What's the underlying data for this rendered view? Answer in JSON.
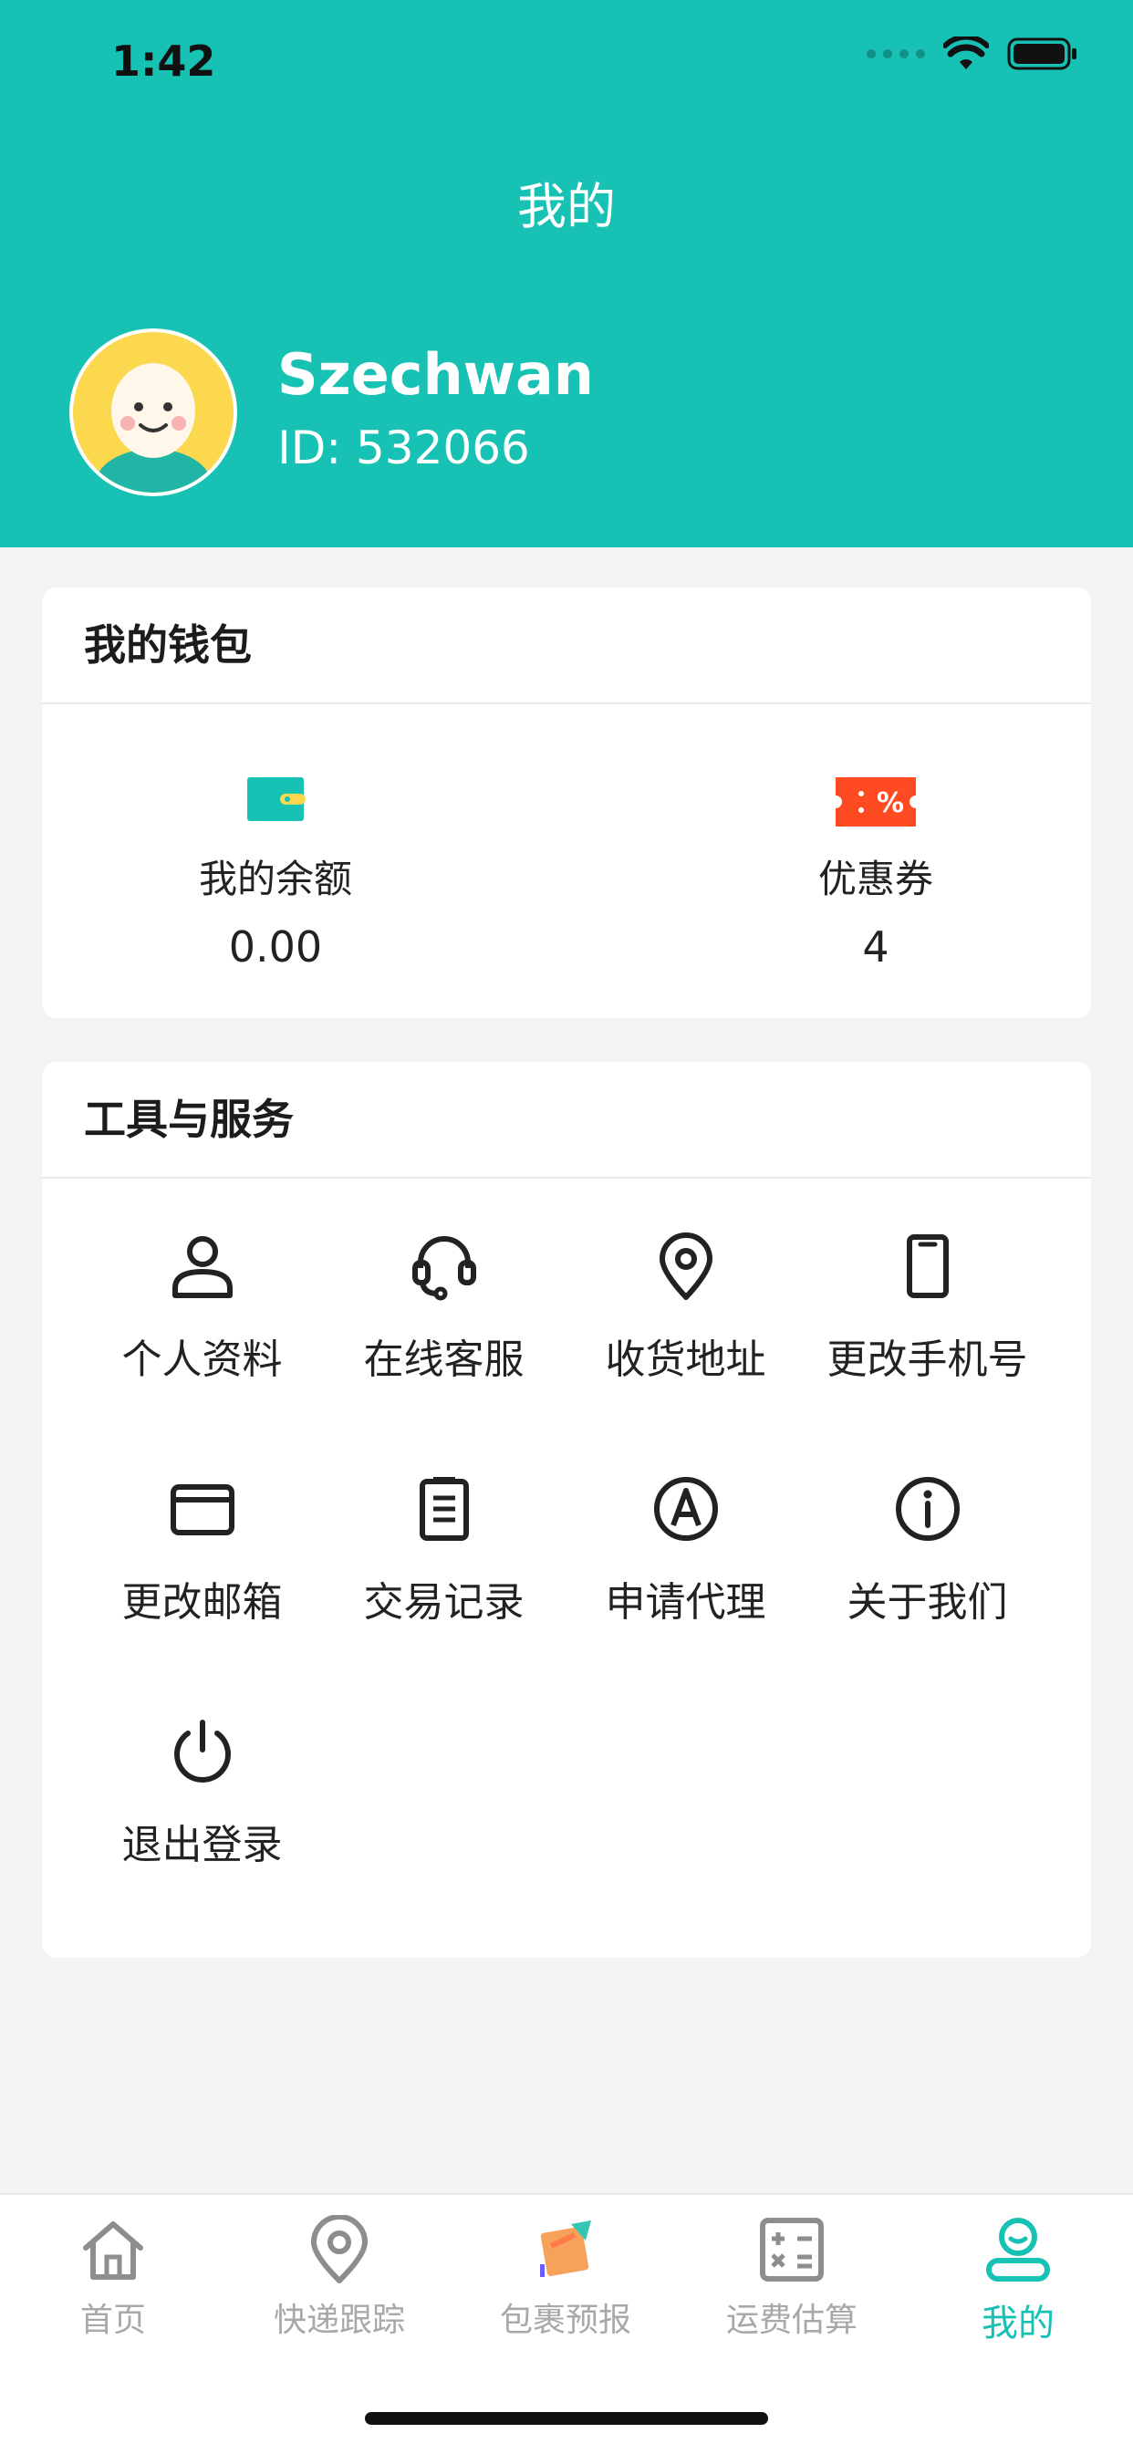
{
  "status_bar": {
    "time": "1:42"
  },
  "header": {
    "title": "我的",
    "username": "Szechwan",
    "user_id": "ID: 532066"
  },
  "wallet": {
    "title": "我的钱包",
    "balance_label": "我的余额",
    "balance_value": "0.00",
    "coupon_label": "优惠券",
    "coupon_value": "4",
    "colors": {
      "wallet_icon": "#17c1b4",
      "coupon_icon": "#ff4a22"
    }
  },
  "tools": {
    "title": "工具与服务",
    "items": [
      {
        "label": "个人资料",
        "icon": "person-icon"
      },
      {
        "label": "在线客服",
        "icon": "headset-icon"
      },
      {
        "label": "收货地址",
        "icon": "location-pin-icon"
      },
      {
        "label": "更改手机号",
        "icon": "phone-icon"
      },
      {
        "label": "更改邮箱",
        "icon": "envelope-icon"
      },
      {
        "label": "交易记录",
        "icon": "clipboard-icon"
      },
      {
        "label": "申请代理",
        "icon": "circled-a-icon"
      },
      {
        "label": "关于我们",
        "icon": "info-icon"
      },
      {
        "label": "退出登录",
        "icon": "power-icon"
      }
    ]
  },
  "tabbar": {
    "items": [
      {
        "label": "首页",
        "icon": "home-icon"
      },
      {
        "label": "快递跟踪",
        "icon": "location-pin-icon"
      },
      {
        "label": "包裹预报",
        "icon": "package-forecast-icon"
      },
      {
        "label": "运费估算",
        "icon": "calculator-icon"
      },
      {
        "label": "我的",
        "icon": "profile-icon",
        "active": true
      }
    ]
  },
  "colors": {
    "accent": "#17c1b4",
    "background": "#f3f3f4"
  }
}
